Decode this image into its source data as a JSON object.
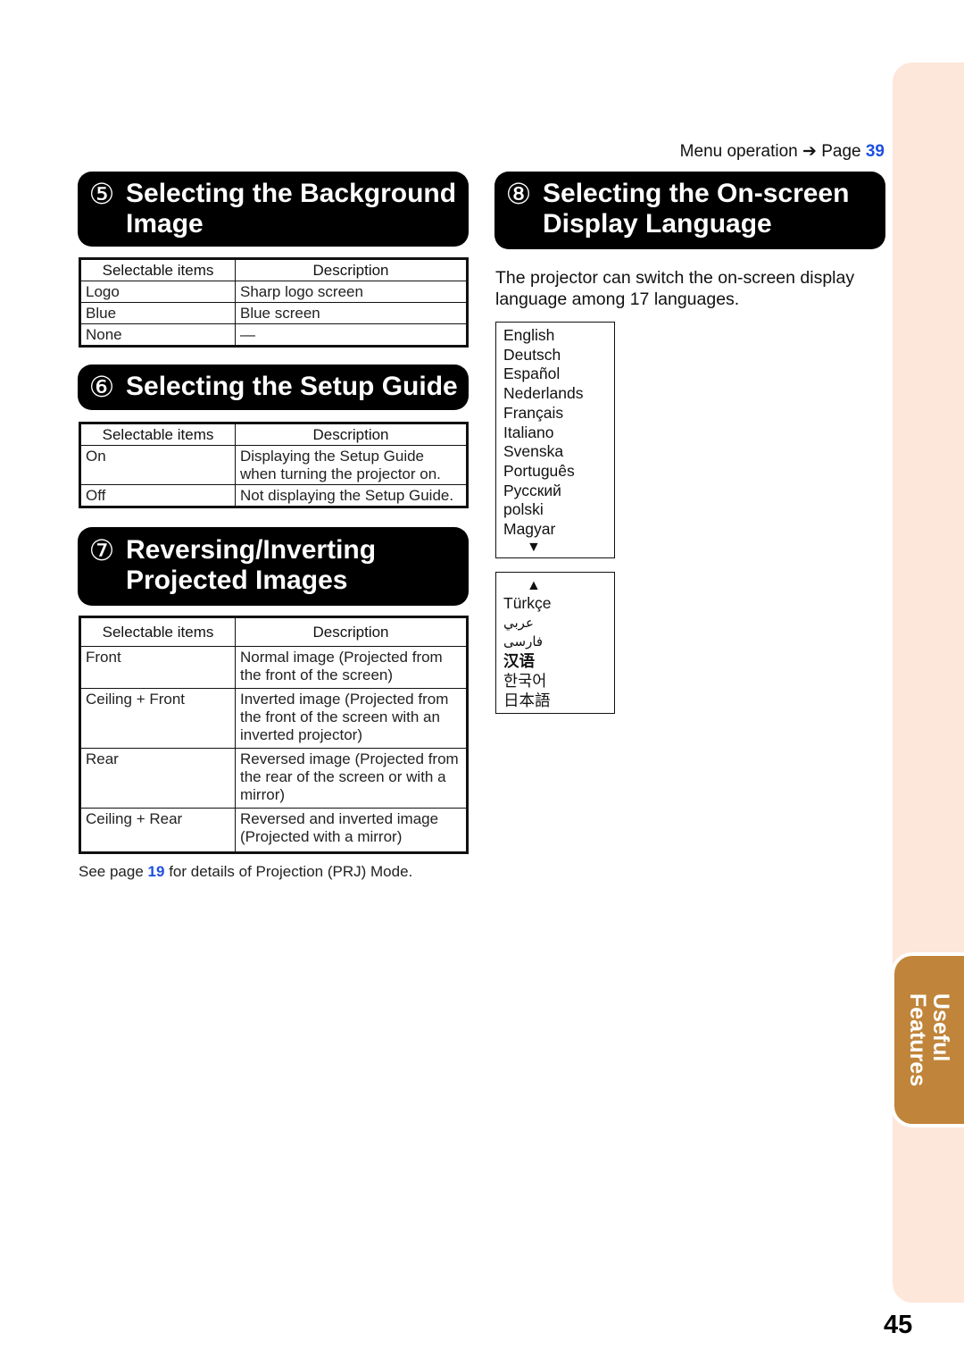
{
  "side_tab": {
    "line1": "Useful",
    "line2": "Features"
  },
  "menu_operation": {
    "label": "Menu operation",
    "arrow": "➔",
    "page_prefix": "Page",
    "page": "39"
  },
  "sections": {
    "background": {
      "number": "⑤",
      "title_line1": "Selecting the Background",
      "title_line2": "Image",
      "headers": [
        "Selectable items",
        "Description"
      ],
      "rows": [
        [
          "Logo",
          "Sharp logo screen"
        ],
        [
          "Blue",
          "Blue screen"
        ],
        [
          "None",
          "—"
        ]
      ]
    },
    "setup_guide": {
      "number": "⑥",
      "title": "Selecting the Setup Guide",
      "headers": [
        "Selectable items",
        "Description"
      ],
      "rows": [
        [
          "On",
          "Displaying the Setup Guide when turning the projector on."
        ],
        [
          "Off",
          "Not displaying the Setup Guide."
        ]
      ]
    },
    "reversing": {
      "number": "⑦",
      "title_line1": "Reversing/Inverting",
      "title_line2": "Projected Images",
      "headers": [
        "Selectable items",
        "Description"
      ],
      "rows": [
        [
          "Front",
          "Normal image (Projected from the front of the screen)"
        ],
        [
          "Ceiling + Front",
          "Inverted image (Projected from the front of the screen with an inverted projector)"
        ],
        [
          "Rear",
          "Reversed image (Projected from the rear of the screen or with a mirror)"
        ],
        [
          "Ceiling + Rear",
          "Reversed and inverted image (Projected with a mirror)"
        ]
      ],
      "note_prefix": "See page",
      "note_page": "19",
      "note_suffix": "for details of Projection (PRJ) Mode."
    },
    "language": {
      "number": "⑧",
      "title_line1": "Selecting the On-screen",
      "title_line2": "Display Language",
      "description": "The projector can switch the on-screen display language among 17 languages.",
      "list_page1": [
        "English",
        "Deutsch",
        "Español",
        "Nederlands",
        "Français",
        "Italiano",
        "Svenska",
        "Português",
        "Русский",
        "polski",
        "Magyar"
      ],
      "list_page2": [
        "Türkçe",
        "عربي",
        "فارسی",
        "汉语",
        "한국어",
        "日本語"
      ],
      "scroll_down_glyph": "▼",
      "scroll_up_glyph": "▲"
    }
  },
  "page_number": "45"
}
